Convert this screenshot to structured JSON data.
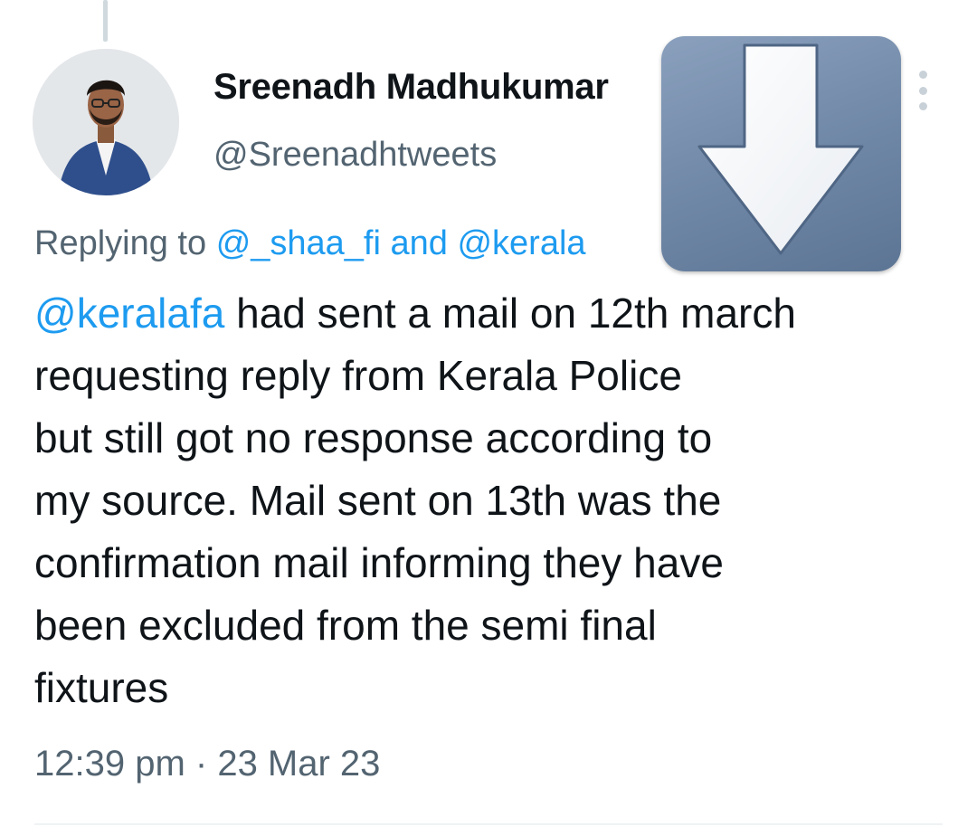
{
  "tweet": {
    "author": {
      "display_name": "Sreenadh Madhukumar",
      "handle": "@Sreenadhtweets"
    },
    "reply": {
      "prefix": "Replying to",
      "mention_1": "@_shaa_fi",
      "joiner": "and",
      "mention_2": "@kerala"
    },
    "text": {
      "mention": "@keralafa",
      "line_1_rest": " had sent a mail on 12th march",
      "line_2": "requesting reply from Kerala Police",
      "line_3": "but still got no response according to",
      "line_4": "my source. Mail sent on 13th was the",
      "line_5": "confirmation mail informing they have",
      "line_6": "been excluded from the semi final",
      "line_7": "fixtures"
    },
    "timestamp": "12:39 pm · 23 Mar 23"
  },
  "icons": {
    "more": "more-vertical-icon",
    "overlay": "down-arrow-icon"
  },
  "colors": {
    "link": "#1d9bf0",
    "secondary_text": "#536471",
    "overlay_bg": "#7189a8"
  }
}
